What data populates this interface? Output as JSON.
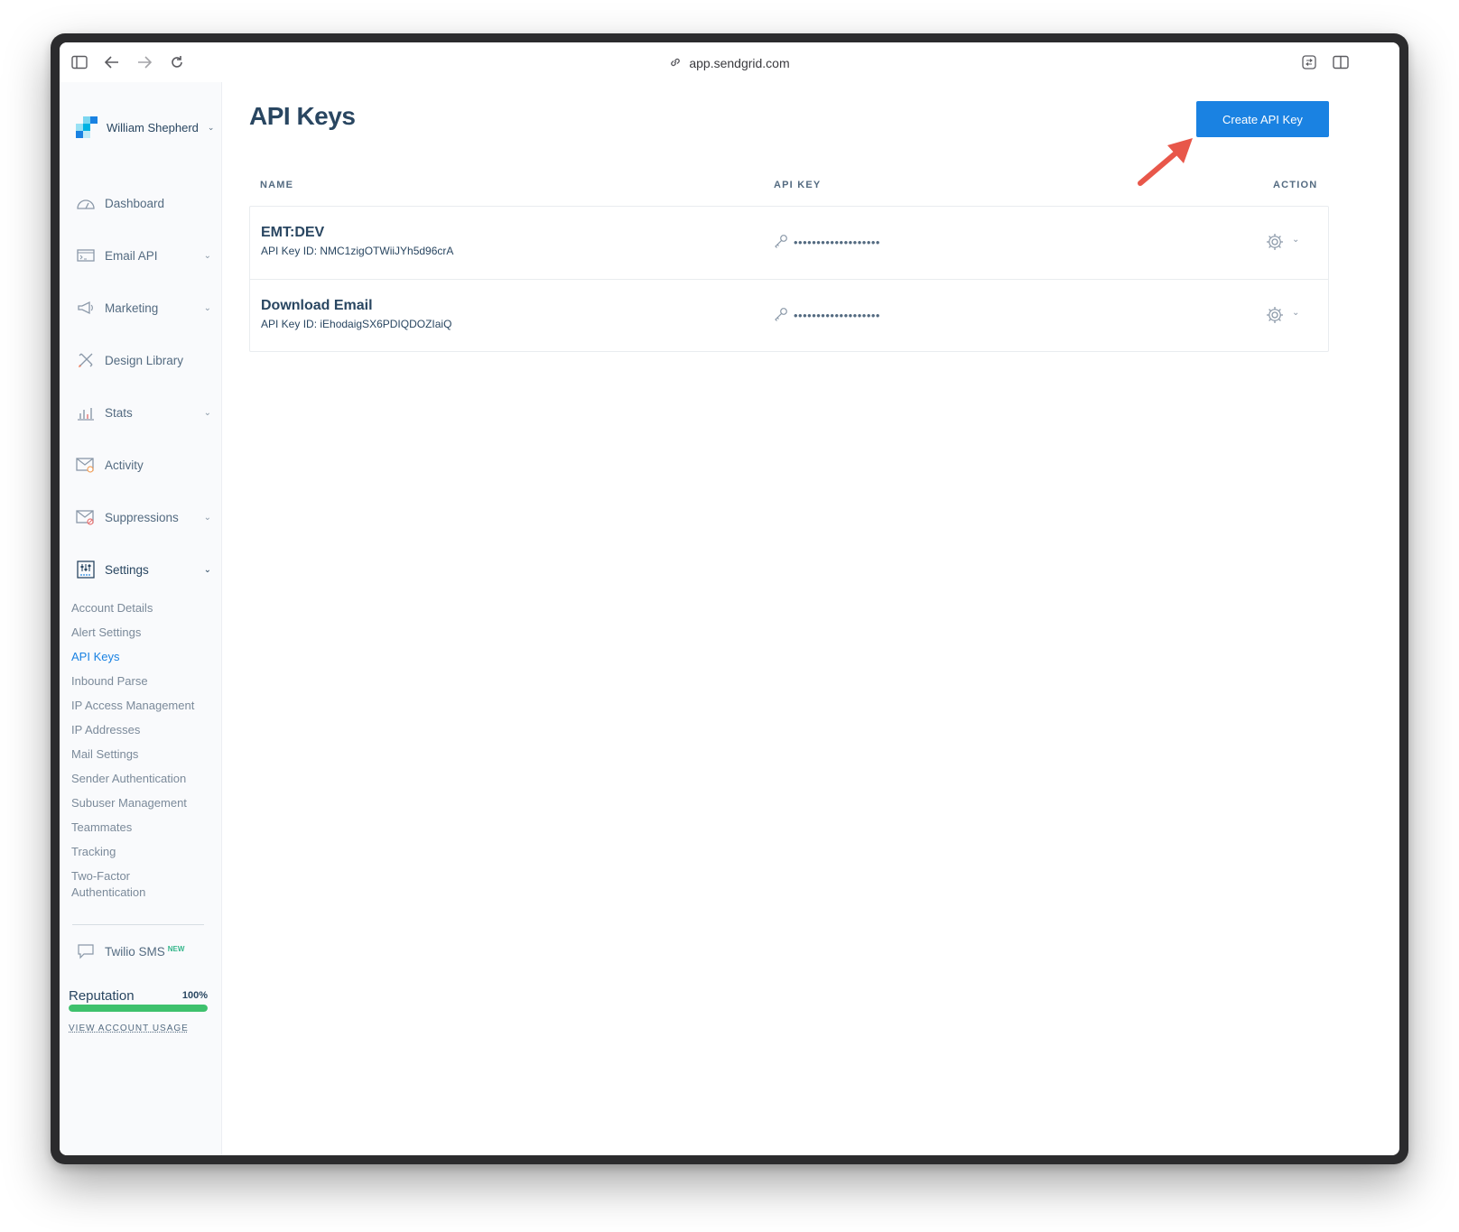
{
  "browser": {
    "url": "app.sendgrid.com"
  },
  "sidebar": {
    "account_name": "William Shepherd",
    "nav": [
      {
        "label": "Dashboard",
        "icon": "dashboard-gauge-icon"
      },
      {
        "label": "Email API",
        "icon": "email-api-icon"
      },
      {
        "label": "Marketing",
        "icon": "megaphone-icon"
      },
      {
        "label": "Design Library",
        "icon": "design-tools-icon"
      },
      {
        "label": "Stats",
        "icon": "stats-chart-icon"
      },
      {
        "label": "Activity",
        "icon": "activity-envelope-icon"
      },
      {
        "label": "Suppressions",
        "icon": "suppressions-envelope-icon"
      },
      {
        "label": "Settings",
        "icon": "settings-sliders-icon"
      }
    ],
    "settings_items": [
      {
        "label": "Account Details"
      },
      {
        "label": "Alert Settings"
      },
      {
        "label": "API Keys",
        "active": true
      },
      {
        "label": "Inbound Parse"
      },
      {
        "label": "IP Access Management"
      },
      {
        "label": "IP Addresses"
      },
      {
        "label": "Mail Settings"
      },
      {
        "label": "Sender Authentication"
      },
      {
        "label": "Subuser Management"
      },
      {
        "label": "Teammates"
      },
      {
        "label": "Tracking"
      },
      {
        "label": "Two-Factor Authentication"
      }
    ],
    "twilio": {
      "label": "Twilio SMS",
      "badge": "NEW"
    },
    "reputation": {
      "label": "Reputation",
      "value_text": "100%",
      "value": 100
    },
    "usage_link": "VIEW ACCOUNT USAGE"
  },
  "main": {
    "title": "API Keys",
    "create_button": "Create API Key",
    "columns": {
      "name": "NAME",
      "api_key": "API KEY",
      "action": "ACTION"
    },
    "keys": [
      {
        "name": "EMT:DEV",
        "id_line": "API Key ID: NMC1zigOTWiiJYh5d96crA",
        "masked": "•••••••••••••••••••"
      },
      {
        "name": "Download Email",
        "id_line": "API Key ID: iEhodaigSX6PDIQDOZIaiQ",
        "masked": "•••••••••••••••••••"
      }
    ]
  },
  "colors": {
    "accent": "#1a82e2",
    "text": "#294661",
    "reputation": "#3ec16d",
    "annotation_arrow": "#e8574a"
  }
}
